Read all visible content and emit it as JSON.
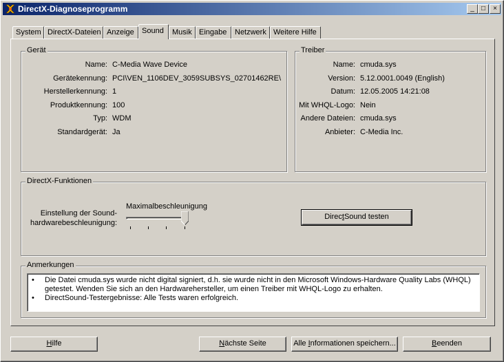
{
  "window": {
    "title": "DirectX-Diagnoseprogramm"
  },
  "titlebar_buttons": {
    "minimize": "_",
    "maximize": "□",
    "close": "×"
  },
  "tabs": [
    "System",
    "DirectX-Dateien",
    "Anzeige",
    "Sound",
    "Musik",
    "Eingabe",
    "Netzwerk",
    "Weitere Hilfe"
  ],
  "active_tab": "Sound",
  "device": {
    "title": "Gerät",
    "rows": [
      {
        "label": "Name:",
        "value": "C-Media Wave Device"
      },
      {
        "label": "Gerätekennung:",
        "value": "PCI\\VEN_1106DEV_3059SUBSYS_02701462RE\\"
      },
      {
        "label": "Herstellerkennung:",
        "value": "1"
      },
      {
        "label": "Produktkennung:",
        "value": "100"
      },
      {
        "label": "Typ:",
        "value": "WDM"
      },
      {
        "label": "Standardgerät:",
        "value": "Ja"
      }
    ]
  },
  "driver": {
    "title": "Treiber",
    "rows": [
      {
        "label": "Name:",
        "value": "cmuda.sys"
      },
      {
        "label": "Version:",
        "value": "5.12.0001.0049 (English)"
      },
      {
        "label": "Datum:",
        "value": "12.05.2005 14:21:08"
      },
      {
        "label": "Mit WHQL-Logo:",
        "value": "Nein"
      },
      {
        "label": "Andere Dateien:",
        "value": "cmuda.sys"
      },
      {
        "label": "Anbieter:",
        "value": "C-Media Inc."
      }
    ]
  },
  "directx_features": {
    "title": "DirectX-Funktionen",
    "accel_label_line1": "Einstellung der Sound-",
    "accel_label_line2": "hardwarebeschleunigung:",
    "accel_value": "Maximalbeschleunigung",
    "accel_level_fraction": 1.0,
    "test_button": "DirectSound testen"
  },
  "notes": {
    "title": "Anmerkungen",
    "items": [
      "Die Datei cmuda.sys wurde nicht digital signiert, d.h. sie wurde nicht in den Microsoft Windows-Hardware Quality Labs (WHQL) getestet. Wenden Sie sich an den Hardwarehersteller, um einen Treiber mit WHQL-Logo zu erhalten.",
      "DirectSound-Testergebnisse: Alle Tests waren erfolgreich."
    ],
    "bullet": "•"
  },
  "buttons": {
    "help": "Hilfe",
    "next_page": "Nächste Seite",
    "save_all": "Alle Informationen speichern...",
    "exit": "Beenden"
  }
}
